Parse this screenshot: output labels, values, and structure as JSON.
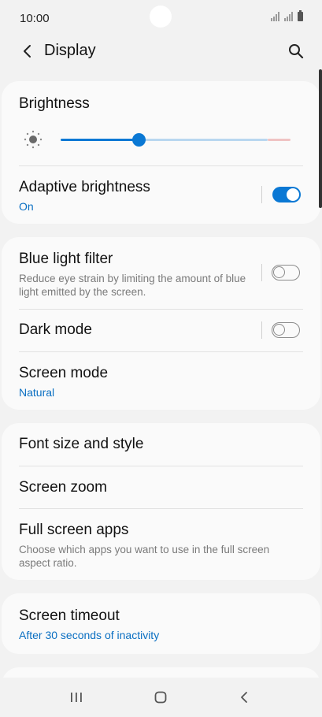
{
  "status_bar": {
    "time": "10:00"
  },
  "app_bar": {
    "title": "Display"
  },
  "brightness": {
    "label": "Brightness",
    "level": 0.34
  },
  "adaptive_brightness": {
    "label": "Adaptive brightness",
    "value": "On",
    "enabled": true
  },
  "blue_light_filter": {
    "label": "Blue light filter",
    "description": "Reduce eye strain by limiting the amount of blue light emitted by the screen.",
    "enabled": false
  },
  "dark_mode": {
    "label": "Dark mode",
    "enabled": false
  },
  "screen_mode": {
    "label": "Screen mode",
    "value": "Natural"
  },
  "font_size": {
    "label": "Font size and style"
  },
  "screen_zoom": {
    "label": "Screen zoom"
  },
  "full_screen_apps": {
    "label": "Full screen apps",
    "description": "Choose which apps you want to use in the full screen aspect ratio."
  },
  "screen_timeout": {
    "label": "Screen timeout",
    "value": "After 30 seconds of inactivity"
  },
  "colors": {
    "accent": "#0a78d4",
    "link": "#0a6fc2",
    "background": "#f2f2f2",
    "card": "#fafafa"
  },
  "icons": {
    "back": "back-arrow-icon",
    "search": "search-icon",
    "brightness": "sun-icon",
    "recents": "recents-icon",
    "home": "home-icon",
    "nav_back": "nav-back-icon"
  }
}
